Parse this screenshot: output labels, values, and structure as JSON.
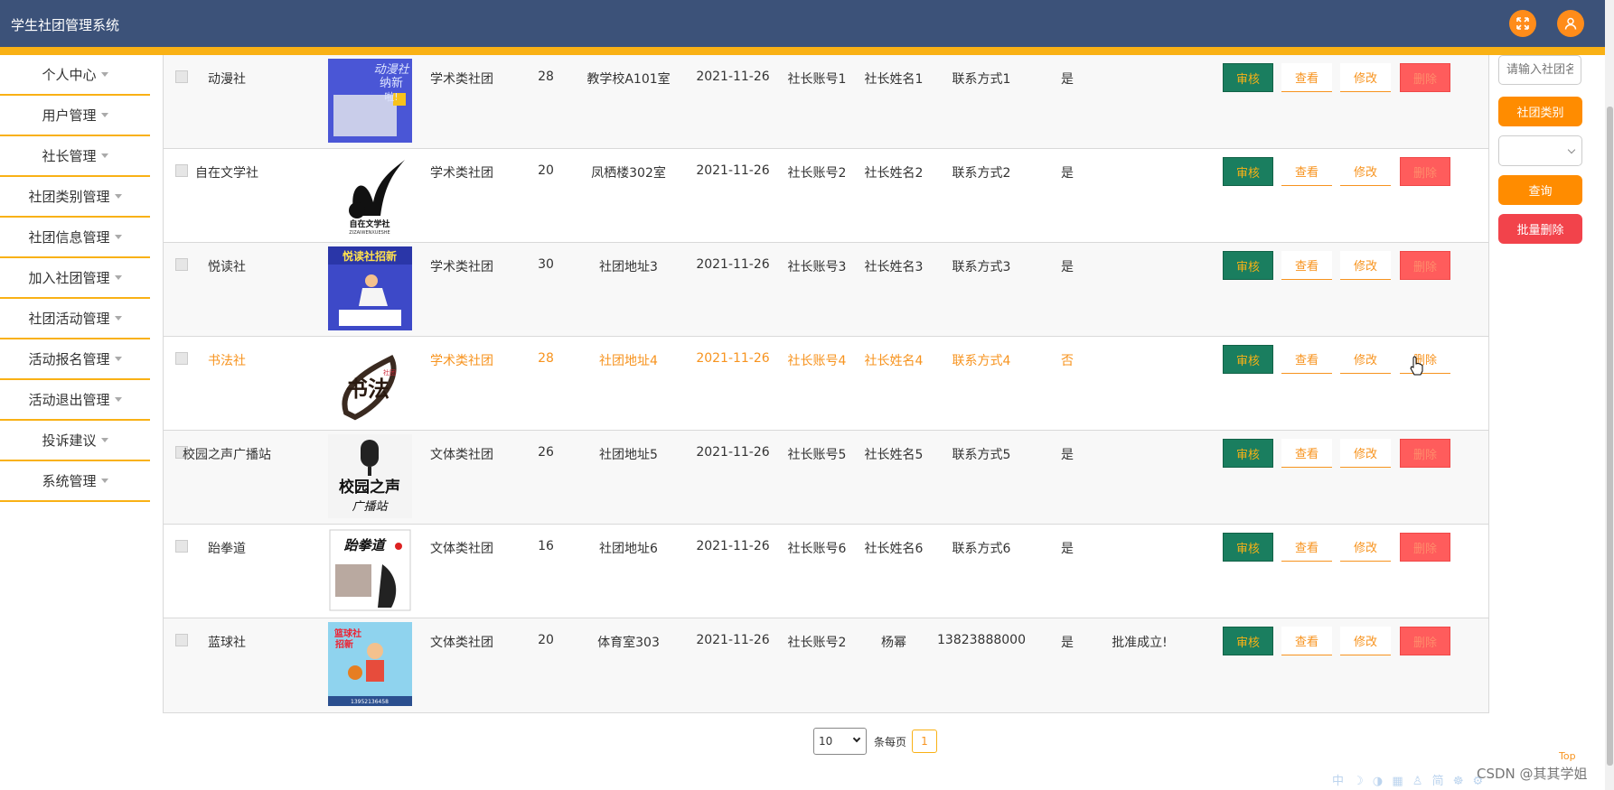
{
  "app": {
    "title": "学生社团管理系统"
  },
  "header": {
    "fullscreen_icon": "fullscreen-icon",
    "user_icon": "user-icon"
  },
  "sidebar": {
    "items": [
      {
        "label": "个人中心"
      },
      {
        "label": "用户管理"
      },
      {
        "label": "社长管理"
      },
      {
        "label": "社团类别管理"
      },
      {
        "label": "社团信息管理"
      },
      {
        "label": "加入社团管理"
      },
      {
        "label": "社团活动管理"
      },
      {
        "label": "活动报名管理"
      },
      {
        "label": "活动退出管理"
      },
      {
        "label": "投诉建议"
      },
      {
        "label": "系统管理"
      }
    ]
  },
  "actions": {
    "audit": "审核",
    "view": "查看",
    "edit": "修改",
    "delete": "删除"
  },
  "rows": [
    {
      "name": "动漫社",
      "category": "学术类社团",
      "members": "28",
      "address": "教学校A101室",
      "date": "2021-11-26",
      "leader_account": "社长账号1",
      "leader_name": "社长姓名1",
      "contact": "联系方式1",
      "approved": "是",
      "reply": ""
    },
    {
      "name": "自在文学社",
      "category": "学术类社团",
      "members": "20",
      "address": "凤栖楼302室",
      "date": "2021-11-26",
      "leader_account": "社长账号2",
      "leader_name": "社长姓名2",
      "contact": "联系方式2",
      "approved": "是",
      "reply": ""
    },
    {
      "name": "悦读社",
      "category": "学术类社团",
      "members": "30",
      "address": "社团地址3",
      "date": "2021-11-26",
      "leader_account": "社长账号3",
      "leader_name": "社长姓名3",
      "contact": "联系方式3",
      "approved": "是",
      "reply": ""
    },
    {
      "name": "书法社",
      "category": "学术类社团",
      "members": "28",
      "address": "社团地址4",
      "date": "2021-11-26",
      "leader_account": "社长账号4",
      "leader_name": "社长姓名4",
      "contact": "联系方式4",
      "approved": "否",
      "reply": ""
    },
    {
      "name": "校园之声广播站",
      "category": "文体类社团",
      "members": "26",
      "address": "社团地址5",
      "date": "2021-11-26",
      "leader_account": "社长账号5",
      "leader_name": "社长姓名5",
      "contact": "联系方式5",
      "approved": "是",
      "reply": ""
    },
    {
      "name": "跆拳道",
      "category": "文体类社团",
      "members": "16",
      "address": "社团地址6",
      "date": "2021-11-26",
      "leader_account": "社长账号6",
      "leader_name": "社长姓名6",
      "contact": "联系方式6",
      "approved": "是",
      "reply": ""
    },
    {
      "name": "蓝球社",
      "category": "文体类社团",
      "members": "20",
      "address": "体育室303",
      "date": "2021-11-26",
      "leader_account": "社长账号2",
      "leader_name": "杨幂",
      "contact": "13823888000",
      "approved": "是",
      "reply": "批准成立!"
    }
  ],
  "thumbnails": {
    "r0": {
      "line1": "动漫社",
      "line2": "纳新",
      "line3": "啦!"
    },
    "r1": {
      "caption": "自在文学社",
      "sub": "ZIZAIWENXUESHE"
    },
    "r2": {
      "banner": "悦读社招新"
    },
    "r3": {
      "calligraphy": "书法",
      "seal": "社团"
    },
    "r4": {
      "line1": "校园之声",
      "line2": "广播站"
    },
    "r5": {
      "title": "跆拳道"
    },
    "r6": {
      "line1": "篮球社",
      "line2": "招新",
      "phone": "13952136458"
    }
  },
  "right_panel": {
    "search_placeholder": "请输入社团名称",
    "category_button": "社团类别",
    "query_button": "查询",
    "batch_delete_button": "批量删除"
  },
  "pagination": {
    "page_size": "10",
    "per_page_label": "条每页",
    "current_page": "1"
  },
  "footer": {
    "top_link": "Top",
    "watermark": "CSDN @其其学姐",
    "tray": "中 ☽ ◑ ▦ ♙ 简 ☸ ⚙"
  },
  "colors": {
    "header": "#3c5279",
    "accent": "#f9b115",
    "audit": "#1a7e5f",
    "delete": "#ff5c5c",
    "orange": "#ff8c00"
  }
}
